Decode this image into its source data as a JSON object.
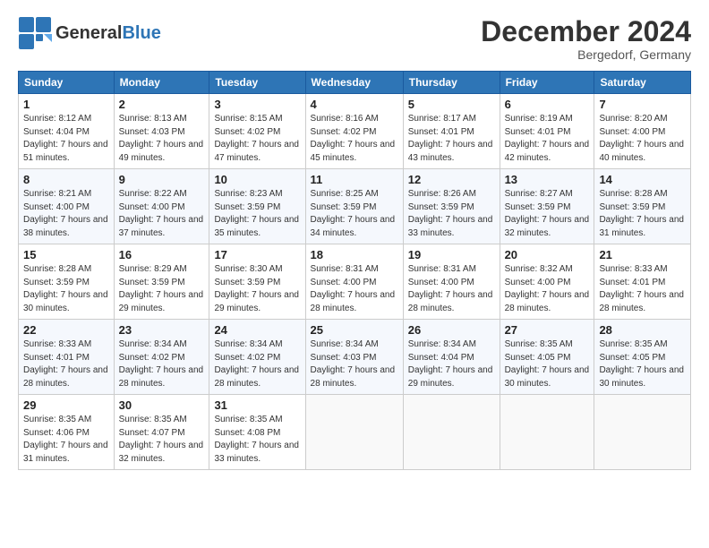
{
  "header": {
    "logo_general": "General",
    "logo_blue": "Blue",
    "month_title": "December 2024",
    "location": "Bergedorf, Germany"
  },
  "columns": [
    "Sunday",
    "Monday",
    "Tuesday",
    "Wednesday",
    "Thursday",
    "Friday",
    "Saturday"
  ],
  "weeks": [
    [
      {
        "day": "1",
        "sunrise": "Sunrise: 8:12 AM",
        "sunset": "Sunset: 4:04 PM",
        "daylight": "Daylight: 7 hours and 51 minutes."
      },
      {
        "day": "2",
        "sunrise": "Sunrise: 8:13 AM",
        "sunset": "Sunset: 4:03 PM",
        "daylight": "Daylight: 7 hours and 49 minutes."
      },
      {
        "day": "3",
        "sunrise": "Sunrise: 8:15 AM",
        "sunset": "Sunset: 4:02 PM",
        "daylight": "Daylight: 7 hours and 47 minutes."
      },
      {
        "day": "4",
        "sunrise": "Sunrise: 8:16 AM",
        "sunset": "Sunset: 4:02 PM",
        "daylight": "Daylight: 7 hours and 45 minutes."
      },
      {
        "day": "5",
        "sunrise": "Sunrise: 8:17 AM",
        "sunset": "Sunset: 4:01 PM",
        "daylight": "Daylight: 7 hours and 43 minutes."
      },
      {
        "day": "6",
        "sunrise": "Sunrise: 8:19 AM",
        "sunset": "Sunset: 4:01 PM",
        "daylight": "Daylight: 7 hours and 42 minutes."
      },
      {
        "day": "7",
        "sunrise": "Sunrise: 8:20 AM",
        "sunset": "Sunset: 4:00 PM",
        "daylight": "Daylight: 7 hours and 40 minutes."
      }
    ],
    [
      {
        "day": "8",
        "sunrise": "Sunrise: 8:21 AM",
        "sunset": "Sunset: 4:00 PM",
        "daylight": "Daylight: 7 hours and 38 minutes."
      },
      {
        "day": "9",
        "sunrise": "Sunrise: 8:22 AM",
        "sunset": "Sunset: 4:00 PM",
        "daylight": "Daylight: 7 hours and 37 minutes."
      },
      {
        "day": "10",
        "sunrise": "Sunrise: 8:23 AM",
        "sunset": "Sunset: 3:59 PM",
        "daylight": "Daylight: 7 hours and 35 minutes."
      },
      {
        "day": "11",
        "sunrise": "Sunrise: 8:25 AM",
        "sunset": "Sunset: 3:59 PM",
        "daylight": "Daylight: 7 hours and 34 minutes."
      },
      {
        "day": "12",
        "sunrise": "Sunrise: 8:26 AM",
        "sunset": "Sunset: 3:59 PM",
        "daylight": "Daylight: 7 hours and 33 minutes."
      },
      {
        "day": "13",
        "sunrise": "Sunrise: 8:27 AM",
        "sunset": "Sunset: 3:59 PM",
        "daylight": "Daylight: 7 hours and 32 minutes."
      },
      {
        "day": "14",
        "sunrise": "Sunrise: 8:28 AM",
        "sunset": "Sunset: 3:59 PM",
        "daylight": "Daylight: 7 hours and 31 minutes."
      }
    ],
    [
      {
        "day": "15",
        "sunrise": "Sunrise: 8:28 AM",
        "sunset": "Sunset: 3:59 PM",
        "daylight": "Daylight: 7 hours and 30 minutes."
      },
      {
        "day": "16",
        "sunrise": "Sunrise: 8:29 AM",
        "sunset": "Sunset: 3:59 PM",
        "daylight": "Daylight: 7 hours and 29 minutes."
      },
      {
        "day": "17",
        "sunrise": "Sunrise: 8:30 AM",
        "sunset": "Sunset: 3:59 PM",
        "daylight": "Daylight: 7 hours and 29 minutes."
      },
      {
        "day": "18",
        "sunrise": "Sunrise: 8:31 AM",
        "sunset": "Sunset: 4:00 PM",
        "daylight": "Daylight: 7 hours and 28 minutes."
      },
      {
        "day": "19",
        "sunrise": "Sunrise: 8:31 AM",
        "sunset": "Sunset: 4:00 PM",
        "daylight": "Daylight: 7 hours and 28 minutes."
      },
      {
        "day": "20",
        "sunrise": "Sunrise: 8:32 AM",
        "sunset": "Sunset: 4:00 PM",
        "daylight": "Daylight: 7 hours and 28 minutes."
      },
      {
        "day": "21",
        "sunrise": "Sunrise: 8:33 AM",
        "sunset": "Sunset: 4:01 PM",
        "daylight": "Daylight: 7 hours and 28 minutes."
      }
    ],
    [
      {
        "day": "22",
        "sunrise": "Sunrise: 8:33 AM",
        "sunset": "Sunset: 4:01 PM",
        "daylight": "Daylight: 7 hours and 28 minutes."
      },
      {
        "day": "23",
        "sunrise": "Sunrise: 8:34 AM",
        "sunset": "Sunset: 4:02 PM",
        "daylight": "Daylight: 7 hours and 28 minutes."
      },
      {
        "day": "24",
        "sunrise": "Sunrise: 8:34 AM",
        "sunset": "Sunset: 4:02 PM",
        "daylight": "Daylight: 7 hours and 28 minutes."
      },
      {
        "day": "25",
        "sunrise": "Sunrise: 8:34 AM",
        "sunset": "Sunset: 4:03 PM",
        "daylight": "Daylight: 7 hours and 28 minutes."
      },
      {
        "day": "26",
        "sunrise": "Sunrise: 8:34 AM",
        "sunset": "Sunset: 4:04 PM",
        "daylight": "Daylight: 7 hours and 29 minutes."
      },
      {
        "day": "27",
        "sunrise": "Sunrise: 8:35 AM",
        "sunset": "Sunset: 4:05 PM",
        "daylight": "Daylight: 7 hours and 30 minutes."
      },
      {
        "day": "28",
        "sunrise": "Sunrise: 8:35 AM",
        "sunset": "Sunset: 4:05 PM",
        "daylight": "Daylight: 7 hours and 30 minutes."
      }
    ],
    [
      {
        "day": "29",
        "sunrise": "Sunrise: 8:35 AM",
        "sunset": "Sunset: 4:06 PM",
        "daylight": "Daylight: 7 hours and 31 minutes."
      },
      {
        "day": "30",
        "sunrise": "Sunrise: 8:35 AM",
        "sunset": "Sunset: 4:07 PM",
        "daylight": "Daylight: 7 hours and 32 minutes."
      },
      {
        "day": "31",
        "sunrise": "Sunrise: 8:35 AM",
        "sunset": "Sunset: 4:08 PM",
        "daylight": "Daylight: 7 hours and 33 minutes."
      },
      null,
      null,
      null,
      null
    ]
  ]
}
